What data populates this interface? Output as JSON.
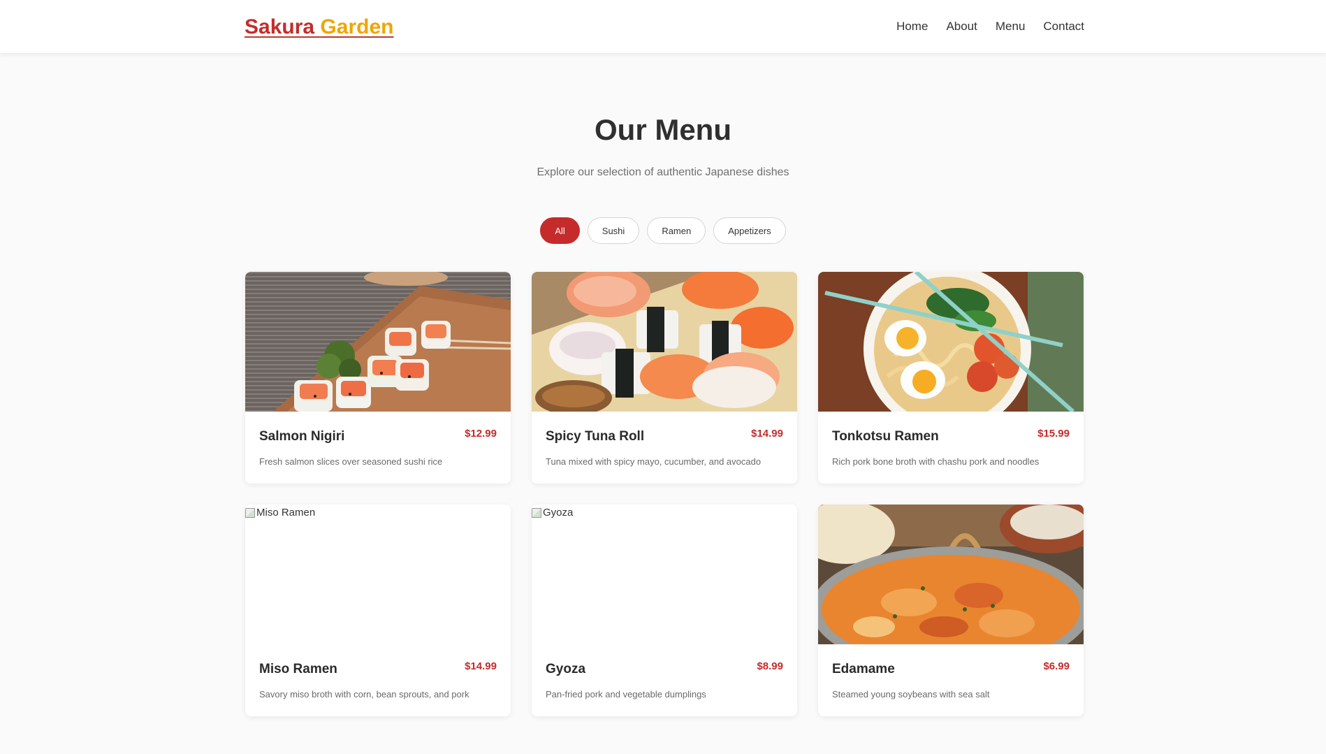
{
  "brand": {
    "word1": "Sakura",
    "word2": "Garden"
  },
  "nav": [
    "Home",
    "About",
    "Menu",
    "Contact"
  ],
  "header": {
    "title": "Our Menu",
    "subtitle": "Explore our selection of authentic Japanese dishes"
  },
  "filters": {
    "all": "All",
    "sushi": "Sushi",
    "ramen": "Ramen",
    "appetizers": "Appetizers",
    "active": "All"
  },
  "items": [
    {
      "name": "Salmon Nigiri",
      "price": "$12.99",
      "description": "Fresh salmon slices over seasoned sushi rice",
      "image": "sushi-rolls-photo"
    },
    {
      "name": "Spicy Tuna Roll",
      "price": "$14.99",
      "description": "Tuna mixed with spicy mayo, cucumber, and avocado",
      "image": "sushi-platter-photo"
    },
    {
      "name": "Tonkotsu Ramen",
      "price": "$15.99",
      "description": "Rich pork bone broth with chashu pork and noodles",
      "image": "ramen-bowl-photo"
    },
    {
      "name": "Miso Ramen",
      "price": "$14.99",
      "description": "Savory miso broth with corn, bean sprouts, and pork",
      "image_alt": "Miso Ramen"
    },
    {
      "name": "Gyoza",
      "price": "$8.99",
      "description": "Pan-fried pork and vegetable dumplings",
      "image_alt": "Gyoza"
    },
    {
      "name": "Edamame",
      "price": "$6.99",
      "description": "Steamed young soybeans with sea salt",
      "image": "curry-dish-photo"
    }
  ],
  "colors": {
    "accent": "#c52b2b",
    "brand_secondary": "#f0a500"
  }
}
